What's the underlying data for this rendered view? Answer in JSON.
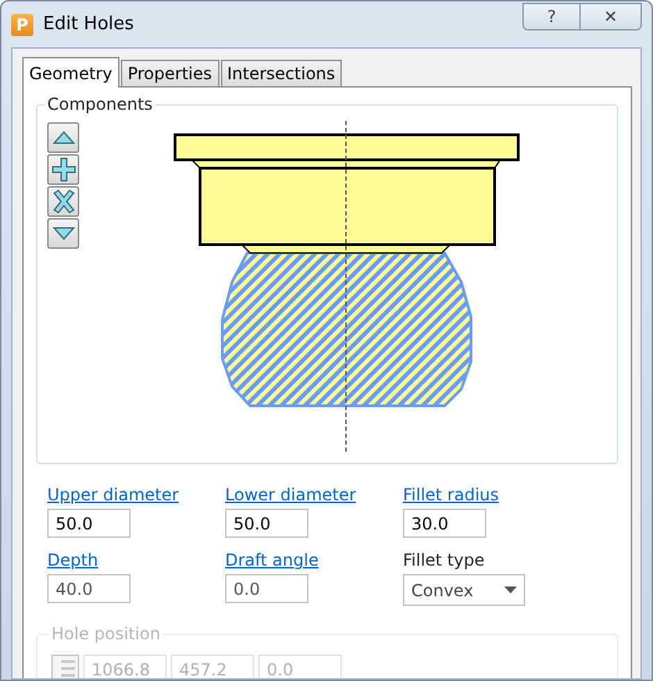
{
  "window": {
    "title": "Edit Holes",
    "app_icon_letter": "P",
    "help": "?",
    "close": "✕"
  },
  "tabs": [
    {
      "label": "Geometry",
      "selected": true
    },
    {
      "label": "Properties",
      "selected": false
    },
    {
      "label": "Intersections",
      "selected": false
    }
  ],
  "components": {
    "title": "Components"
  },
  "fields": [
    {
      "label": "Upper diameter",
      "kind": "link",
      "value": "50.0",
      "disabled": false
    },
    {
      "label": "Lower diameter",
      "kind": "link",
      "value": "50.0",
      "disabled": false
    },
    {
      "label": "Fillet radius",
      "kind": "link",
      "value": "30.0",
      "disabled": false
    },
    {
      "label": "Depth",
      "kind": "link",
      "value": "40.0",
      "disabled": true
    },
    {
      "label": "Draft angle",
      "kind": "link",
      "value": "0.0",
      "disabled": true
    },
    {
      "label": "Fillet type",
      "kind": "select",
      "value": "Convex",
      "disabled": false
    }
  ],
  "hole_position": {
    "title": "Hole position",
    "disabled": true,
    "values": [
      "1066.8",
      "457.2",
      "0.0"
    ]
  }
}
